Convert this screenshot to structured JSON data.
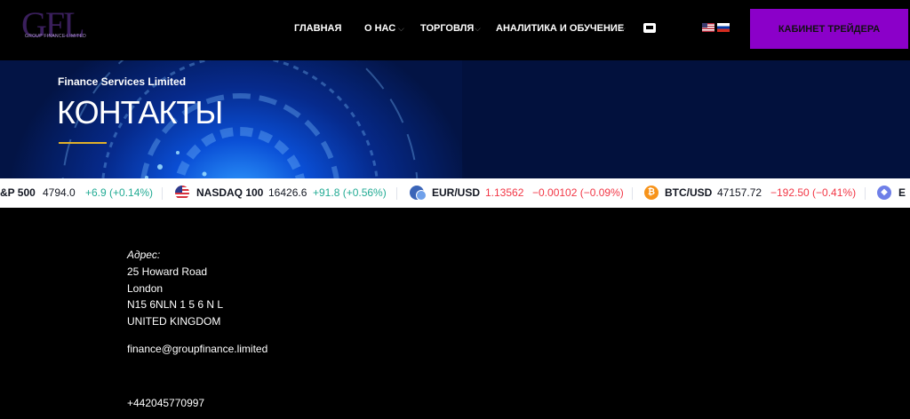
{
  "brand": {
    "mark": "GFL",
    "sub": "GROUP FINANCE LIMITED"
  },
  "nav": {
    "items": [
      {
        "label": "ГЛАВНАЯ",
        "dropdown": false
      },
      {
        "label": "О НАС",
        "dropdown": true
      },
      {
        "label": "ТОРГОВЛЯ",
        "dropdown": true
      },
      {
        "label": "АНАЛИТИКА И ОБУЧЕНИЕ",
        "dropdown": true
      }
    ],
    "icons": [
      "device-icon",
      "flag-us-icon",
      "flag-ru-icon"
    ],
    "cta_label": "КАБИНЕТ ТРЕЙДЕРА"
  },
  "banner": {
    "subtitle": "Finance Services Limited",
    "title": "КОНТАКТЫ"
  },
  "ticker": [
    {
      "name": "&P 500",
      "price": "4794.0",
      "change": "+6.9 (+0.14%)",
      "dir": "up",
      "icon": ""
    },
    {
      "name": "NASDAQ 100",
      "price": "16426.6",
      "change": "+91.8 (+0.56%)",
      "dir": "up",
      "icon": "us-flag-icon"
    },
    {
      "name": "EUR/USD",
      "price": "1.13562",
      "change": "−0.00102 (−0.09%)",
      "dir": "down",
      "icon": "eur-usd-icon"
    },
    {
      "name": "BTC/USD",
      "price": "47157.72",
      "change": "−192.50 (−0.41%)",
      "dir": "down",
      "icon": "bitcoin-icon"
    },
    {
      "name": "E",
      "price": "",
      "change": "",
      "dir": "",
      "icon": "ethereum-icon"
    }
  ],
  "contacts": {
    "address_label": "Адрес:",
    "address_lines": [
      "25 Howard Road",
      "London",
      "N15 6NLN 1 5 6 N L",
      "UNITED KINGDOM"
    ],
    "email": "finance@groupfinance.limited",
    "phone": "+442045770997"
  },
  "colors": {
    "accent": "#8b00c9",
    "underline": "#e0b02a",
    "up": "#22ab94",
    "down": "#f23645"
  }
}
